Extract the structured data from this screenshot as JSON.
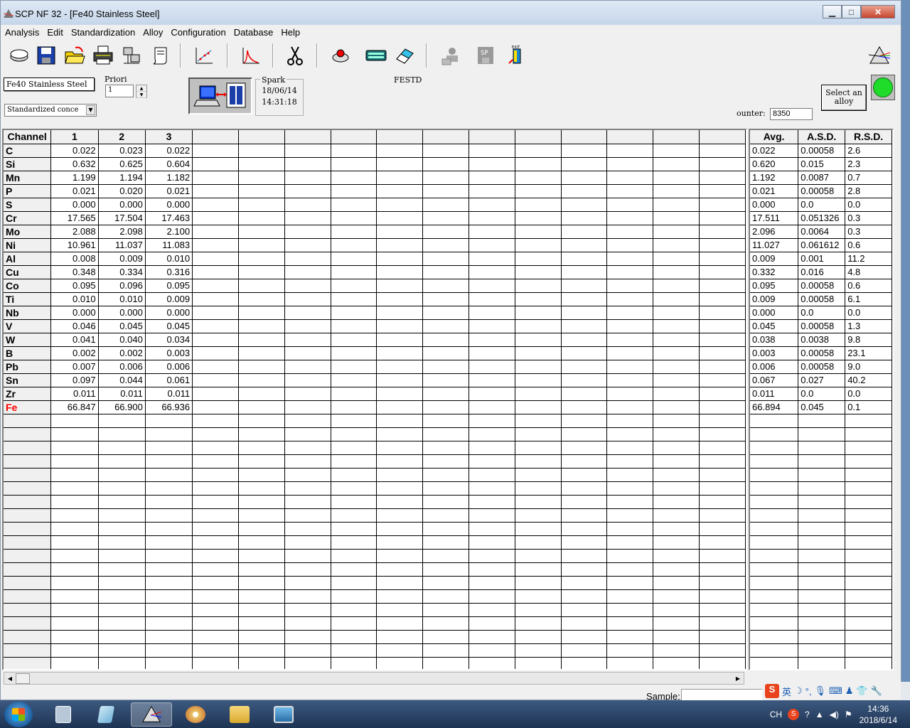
{
  "window": {
    "title": "SCP NF 32 - [Fe40 Stainless Steel]",
    "minimize": "▁",
    "maximize": "□",
    "close": "✕"
  },
  "menu": [
    "Analysis",
    "Edit",
    "Standardization",
    "Alloy",
    "Configuration",
    "Database",
    "Help"
  ],
  "toolbar": {
    "icons": [
      "disk-drive-icon",
      "save-icon",
      "open-folder-icon",
      "printer-icon",
      "network-icon",
      "scroll-icon",
      "calibration-chart-icon",
      "spectrum-peak-icon",
      "scissors-icon",
      "sample-stand-icon",
      "keyboard-icon",
      "eraser-icon",
      "user-disabled-icon",
      "sp-disabled-icon",
      "exit-icon",
      "prism-icon"
    ]
  },
  "controls": {
    "alloy_name": "Fe40 Stainless Steel",
    "mode_select": "Standardized conce",
    "priori_label": "Priori",
    "priori_value": "1",
    "spark_label": "Spark",
    "spark_date": "18/06/14",
    "spark_time": "14:31:18",
    "standard_code": "FESTD",
    "select_alloy_button": "Select an alloy",
    "counter_label": "ounter:",
    "counter_value": "8350",
    "status_color": "#1fdc2a"
  },
  "grid": {
    "headers": [
      "Channel",
      "1",
      "2",
      "3",
      "",
      "",
      "",
      "",
      "",
      "",
      "",
      "",
      "",
      "",
      "",
      ""
    ],
    "rows": [
      {
        "channel": "C",
        "values": [
          "0.022",
          "0.023",
          "0.022"
        ]
      },
      {
        "channel": "Si",
        "values": [
          "0.632",
          "0.625",
          "0.604"
        ]
      },
      {
        "channel": "Mn",
        "values": [
          "1.199",
          "1.194",
          "1.182"
        ]
      },
      {
        "channel": "P",
        "values": [
          "0.021",
          "0.020",
          "0.021"
        ]
      },
      {
        "channel": "S",
        "values": [
          "0.000",
          "0.000",
          "0.000"
        ]
      },
      {
        "channel": "Cr",
        "values": [
          "17.565",
          "17.504",
          "17.463"
        ]
      },
      {
        "channel": "Mo",
        "values": [
          "2.088",
          "2.098",
          "2.100"
        ]
      },
      {
        "channel": "Ni",
        "values": [
          "10.961",
          "11.037",
          "11.083"
        ]
      },
      {
        "channel": "Al",
        "values": [
          "0.008",
          "0.009",
          "0.010"
        ]
      },
      {
        "channel": "Cu",
        "values": [
          "0.348",
          "0.334",
          "0.316"
        ]
      },
      {
        "channel": "Co",
        "values": [
          "0.095",
          "0.096",
          "0.095"
        ]
      },
      {
        "channel": "Ti",
        "values": [
          "0.010",
          "0.010",
          "0.009"
        ]
      },
      {
        "channel": "Nb",
        "values": [
          "0.000",
          "0.000",
          "0.000"
        ]
      },
      {
        "channel": "V",
        "values": [
          "0.046",
          "0.045",
          "0.045"
        ]
      },
      {
        "channel": "W",
        "values": [
          "0.041",
          "0.040",
          "0.034"
        ]
      },
      {
        "channel": "B",
        "values": [
          "0.002",
          "0.002",
          "0.003"
        ]
      },
      {
        "channel": "Pb",
        "values": [
          "0.007",
          "0.006",
          "0.006"
        ]
      },
      {
        "channel": "Sn",
        "values": [
          "0.097",
          "0.044",
          "0.061"
        ]
      },
      {
        "channel": "Zr",
        "values": [
          "0.011",
          "0.011",
          "0.011"
        ]
      },
      {
        "channel": "Fe",
        "values": [
          "66.847",
          "66.900",
          "66.936"
        ],
        "highlight": "#ff0000"
      }
    ],
    "empty_rows": 19
  },
  "stats": {
    "headers": [
      "Avg.",
      "A.S.D.",
      "R.S.D."
    ],
    "rows": [
      [
        "0.022",
        "0.00058",
        "2.6"
      ],
      [
        "0.620",
        "0.015",
        "2.3"
      ],
      [
        "1.192",
        "0.0087",
        "0.7"
      ],
      [
        "0.021",
        "0.00058",
        "2.8"
      ],
      [
        "0.000",
        "0.0",
        "0.0"
      ],
      [
        "17.511",
        "0.051326",
        "0.3"
      ],
      [
        "2.096",
        "0.0064",
        "0.3"
      ],
      [
        "11.027",
        "0.061612",
        "0.6"
      ],
      [
        "0.009",
        "0.001",
        "11.2"
      ],
      [
        "0.332",
        "0.016",
        "4.8"
      ],
      [
        "0.095",
        "0.00058",
        "0.6"
      ],
      [
        "0.009",
        "0.00058",
        "6.1"
      ],
      [
        "0.000",
        "0.0",
        "0.0"
      ],
      [
        "0.045",
        "0.00058",
        "1.3"
      ],
      [
        "0.038",
        "0.0038",
        "9.8"
      ],
      [
        "0.003",
        "0.00058",
        "23.1"
      ],
      [
        "0.006",
        "0.00058",
        "9.0"
      ],
      [
        "0.067",
        "0.027",
        "40.2"
      ],
      [
        "0.011",
        "0.0",
        "0.0"
      ],
      [
        "66.894",
        "0.045",
        "0.1"
      ]
    ]
  },
  "footer": {
    "sample_label": "Sample:"
  },
  "taskbar": {
    "apps": [
      "calculator-icon",
      "notepad-icon",
      "scp-prism-icon",
      "paint-icon",
      "explorer-icon",
      "image-viewer-icon"
    ],
    "lang": "CH",
    "time": "14:36",
    "date": "2018/6/14",
    "ime_label": "英"
  }
}
